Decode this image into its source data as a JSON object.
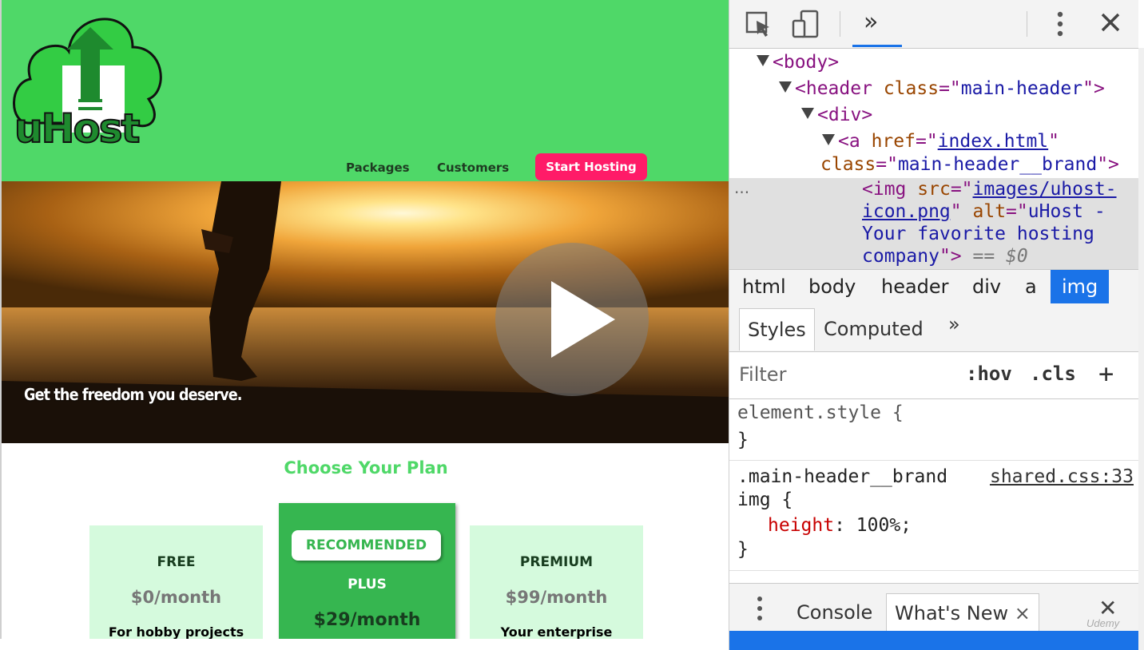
{
  "site": {
    "brand": {
      "logo_alt": "uHost - Your favorite hosting company",
      "logo_text": "uHost"
    },
    "nav": {
      "items": [
        "Packages",
        "Customers"
      ],
      "cta": "Start Hosting"
    },
    "hero": {
      "text": "Get the freedom you deserve."
    },
    "plans": {
      "title": "Choose Your Plan",
      "items": [
        {
          "name": "FREE",
          "price": "$0/month",
          "desc": "For hobby projects"
        },
        {
          "badge": "RECOMMENDED",
          "name": "PLUS",
          "price": "$29/month"
        },
        {
          "name": "PREMIUM",
          "price": "$99/month",
          "desc": "Your enterprise"
        }
      ]
    },
    "colors": {
      "header_green": "#4fd868",
      "cta_pink": "#ff1b68",
      "plan_light": "#d5fadd",
      "plan_plus": "#36b650"
    }
  },
  "devtools": {
    "toolbar": {
      "more_tabs": "»"
    },
    "dom": {
      "body_tag": "body",
      "header_tag": "header",
      "header_attr": "class",
      "header_class": "main-header",
      "div_tag": "div",
      "a_tag": "a",
      "a_href_attr": "href",
      "a_href": "index.html",
      "a_class_attr": "class",
      "a_class": "main-header__brand",
      "img_tag": "img",
      "img_src_attr": "src",
      "img_src_1": "images/uhost-",
      "img_src_2": "icon.png",
      "img_alt_attr": "alt",
      "img_alt_1": "uHost -",
      "img_alt_2": "Your favorite hosting",
      "img_alt_3": "company",
      "selected_marker": "== $0",
      "dots": "..."
    },
    "breadcrumbs": [
      "html",
      "body",
      "header",
      "div",
      "a",
      "img"
    ],
    "styles_tabs": {
      "styles": "Styles",
      "computed": "Computed",
      "more": "»"
    },
    "filter": {
      "placeholder": "Filter",
      "hov": ":hov",
      "cls": ".cls",
      "plus": "+"
    },
    "rules": {
      "element_style": "element.style {",
      "close": "}",
      "selector_1": ".main-header__brand",
      "selector_2": "img {",
      "source": "shared.css:33",
      "prop": "height",
      "value": ": 100%;"
    },
    "drawer": {
      "console": "Console",
      "whats_new": "What's New",
      "close_tab": "×",
      "close": "✕"
    },
    "watermark": "Udemy"
  }
}
